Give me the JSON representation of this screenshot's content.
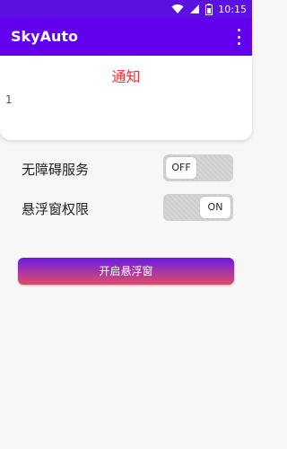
{
  "status_bar": {
    "time": "10:15",
    "icons": [
      "wifi-icon",
      "signal-icon",
      "battery-icon"
    ]
  },
  "app_bar": {
    "title": "SkyAuto",
    "menu_icon": "more-vert-icon"
  },
  "notice": {
    "title": "通知",
    "body": "1"
  },
  "settings": {
    "accessibility_label": "无障碍服务",
    "accessibility_state": "OFF",
    "floating_label": "悬浮窗权限",
    "floating_state": "ON"
  },
  "actions": {
    "open_floating_label": "开启悬浮窗"
  },
  "colors": {
    "primary": "#6200ee",
    "notice_title": "#e53935"
  }
}
